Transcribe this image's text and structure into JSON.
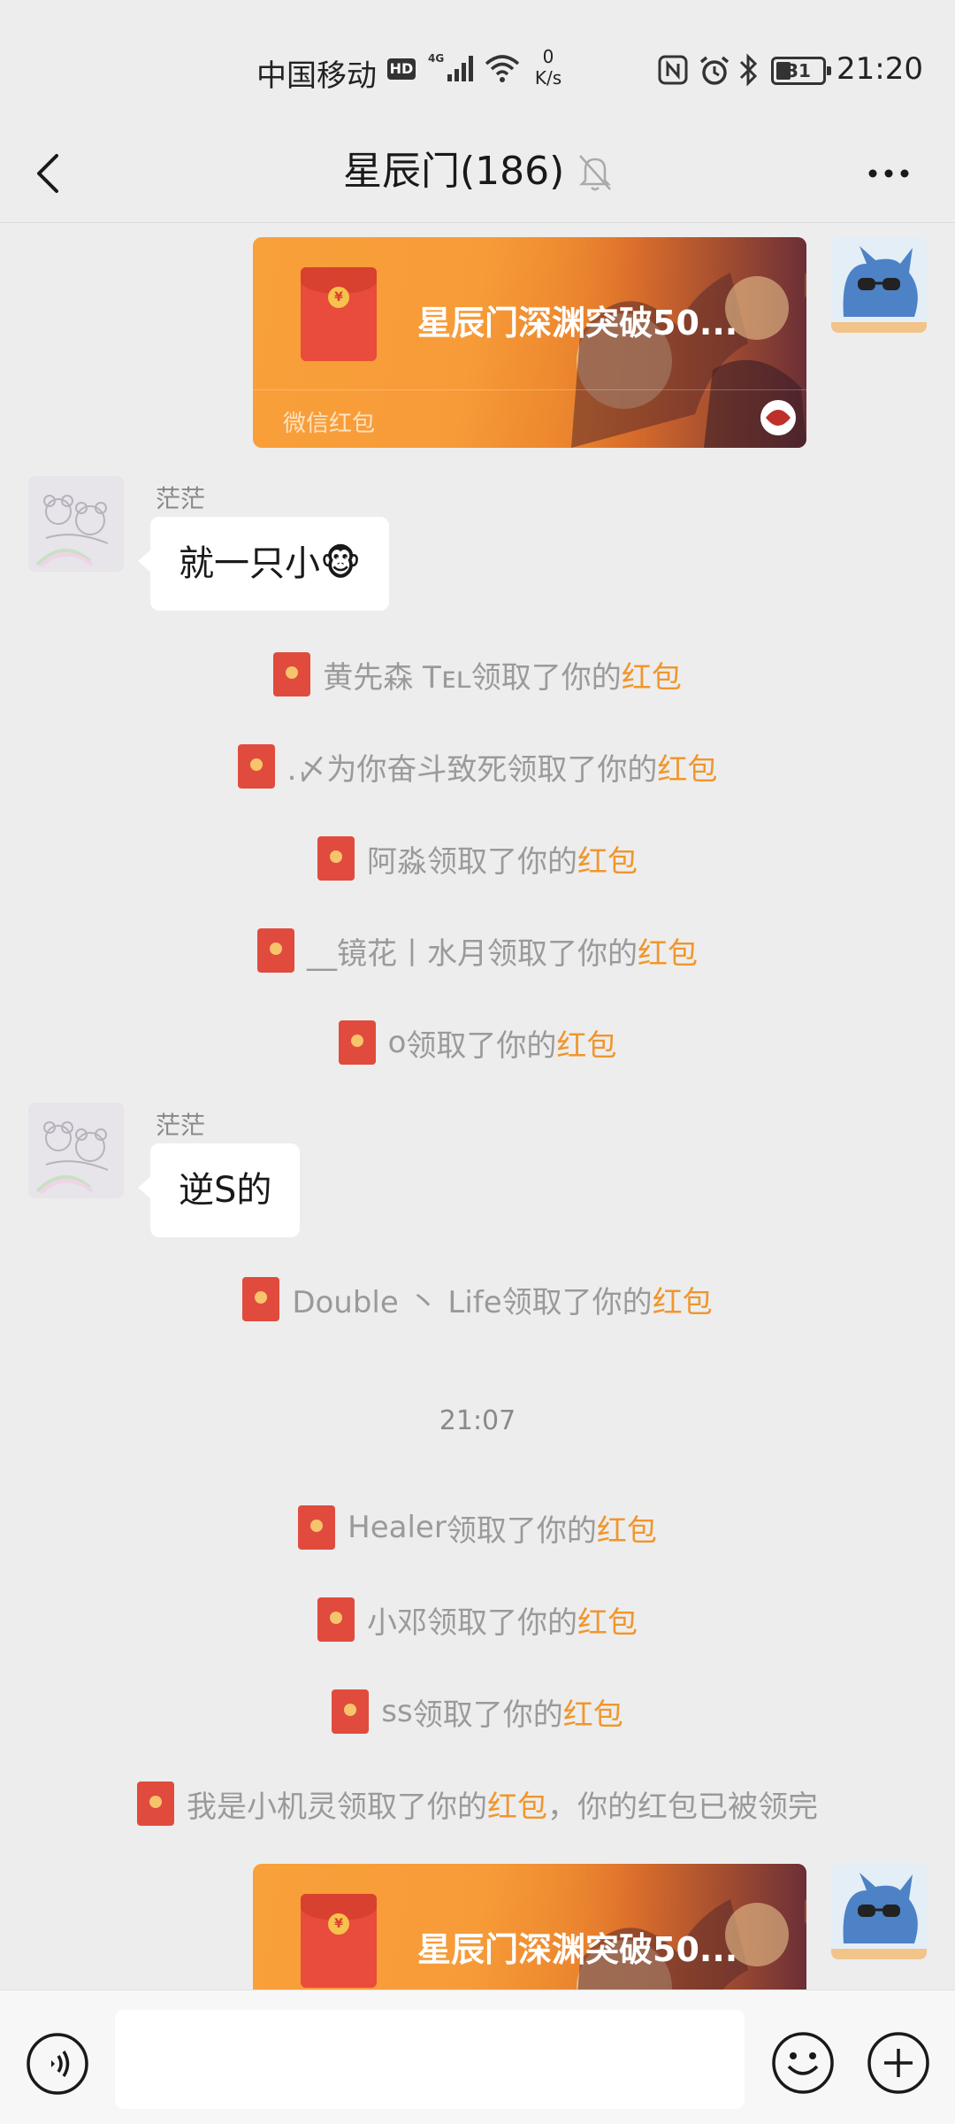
{
  "status_bar": {
    "carrier": "中国移动",
    "hd_badge": "HD",
    "network": "4G",
    "speed_value": "0",
    "speed_unit": "K/s",
    "battery": "31",
    "time": "21:20"
  },
  "header": {
    "title": "星辰门(186)"
  },
  "messages": {
    "red_packet_1": {
      "title": "星辰门深渊突破50...",
      "footer": "微信红包"
    },
    "msg_1": {
      "sender": "茫茫",
      "text": "就一只小🐵"
    },
    "sys_1": {
      "name": "黄先森 Tᴇʟ",
      "action": " 领取了你的",
      "link": "红包"
    },
    "sys_2": {
      "name": ".〆为你奋斗致死",
      "action": "领取了你的",
      "link": "红包"
    },
    "sys_3": {
      "name": "阿淼",
      "action": "领取了你的",
      "link": "红包"
    },
    "sys_4": {
      "name": "__镜花丨水月",
      "action": "领取了你的",
      "link": "红包"
    },
    "sys_5": {
      "name": "o",
      "action": " 领取了你的",
      "link": "红包"
    },
    "msg_2": {
      "sender": "茫茫",
      "text": "逆S的"
    },
    "sys_6": {
      "name": "Double 丶 Life",
      "action": " 领取了你的",
      "link": "红包"
    },
    "timestamp": "21:07",
    "sys_7": {
      "name": "Healer",
      "action": " 领取了你的",
      "link": "红包"
    },
    "sys_8": {
      "name": "小邓",
      "action": "领取了你的",
      "link": "红包"
    },
    "sys_9": {
      "name": "ss",
      "action": " 领取了你的",
      "link": "红包"
    },
    "sys_10": {
      "name": "我是小机灵",
      "action": "领取了你的",
      "link": "红包",
      "suffix": "，你的红包已被领完"
    },
    "red_packet_2": {
      "title": "星辰门深渊突破50..."
    }
  },
  "input": {
    "placeholder": ""
  },
  "colors": {
    "background": "#ededed",
    "accent_orange": "#f0962c",
    "red_packet": "#f79b38",
    "envelope_red": "#e04b3e"
  },
  "icons": {
    "back": "chevron-left-icon",
    "mute": "bell-off-icon",
    "more": "more-dots-icon",
    "voice": "voice-icon",
    "emoji": "smiley-icon",
    "plus": "plus-circle-icon"
  }
}
